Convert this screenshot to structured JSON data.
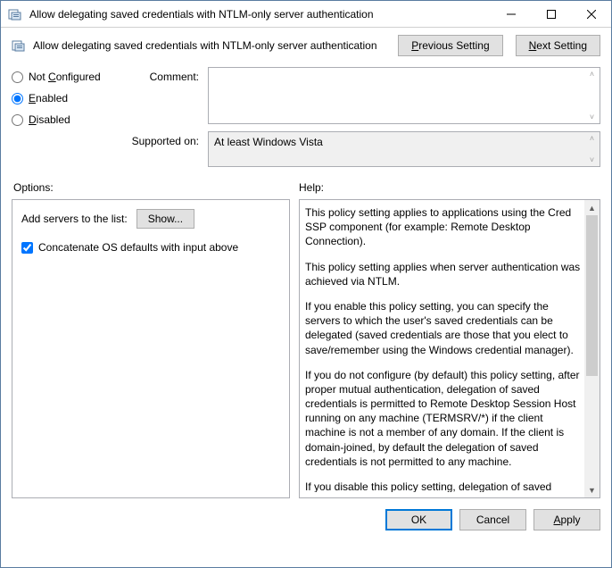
{
  "window": {
    "title": "Allow delegating saved credentials with NTLM-only server authentication"
  },
  "banner": {
    "label": "Allow delegating saved credentials with NTLM-only server authentication",
    "prev": "Previous Setting",
    "next": "Next Setting",
    "next_underline": "N"
  },
  "radios": {
    "not_configured": "Not Configured",
    "enabled": "Enabled",
    "disabled": "Disabled",
    "selected": "enabled"
  },
  "labels": {
    "comment": "Comment:",
    "supported": "Supported on:",
    "options": "Options:",
    "help": "Help:"
  },
  "values": {
    "comment": "",
    "supported": "At least Windows Vista"
  },
  "options": {
    "servers_label": "Add servers to the list:",
    "show_btn": "Show...",
    "concat_checked": true,
    "concat_label": "Concatenate OS defaults with input above"
  },
  "help": {
    "p1": "This policy setting applies to applications using the Cred SSP component (for example: Remote Desktop Connection).",
    "p2": "This policy setting applies when server authentication was achieved via NTLM.",
    "p3": "If you enable this policy setting, you can specify the servers to which the user's saved credentials can be delegated (saved credentials are those that you elect to save/remember using the Windows credential manager).",
    "p4": "If you do not configure (by default) this policy setting, after proper mutual authentication, delegation of saved credentials is permitted to Remote Desktop Session Host running on any machine (TERMSRV/*) if the client machine is not a member of any domain. If the client is domain-joined, by default the delegation of saved credentials is not permitted to any machine.",
    "p5": "If you disable this policy setting, delegation of saved credentials is not permitted to any machine."
  },
  "footer": {
    "ok": "OK",
    "cancel": "Cancel",
    "apply": "Apply"
  }
}
